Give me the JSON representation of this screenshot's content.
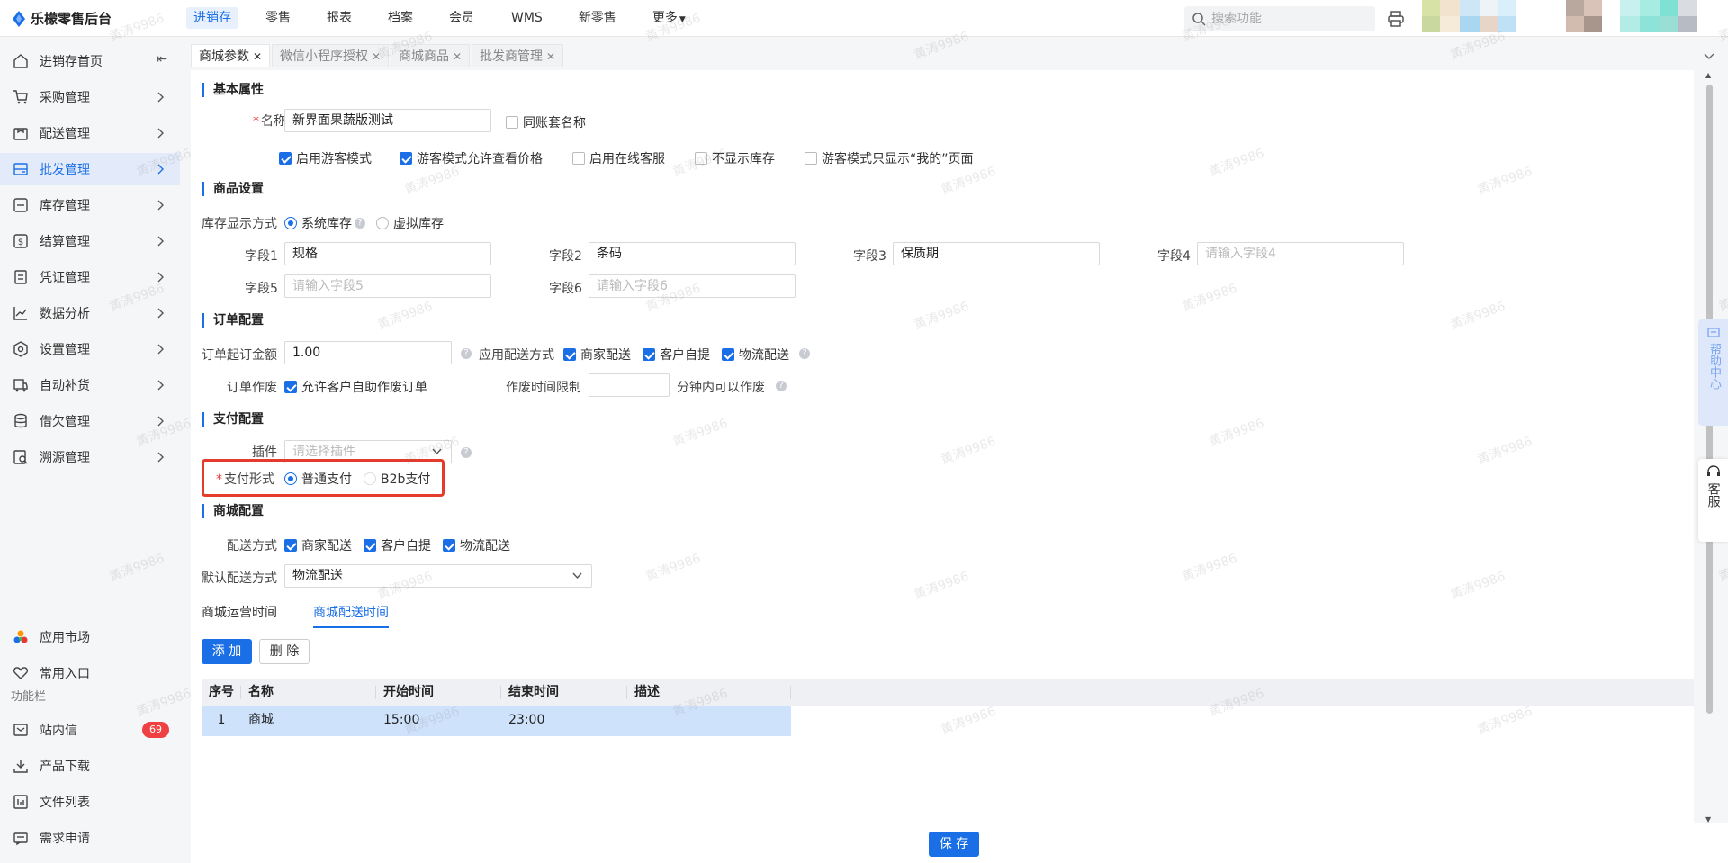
{
  "app": {
    "title": "乐檬零售后台"
  },
  "topnav": {
    "items": [
      {
        "label": "进销存",
        "active": true
      },
      {
        "label": "零售"
      },
      {
        "label": "报表"
      },
      {
        "label": "档案"
      },
      {
        "label": "会员"
      },
      {
        "label": "WMS"
      },
      {
        "label": "新零售"
      },
      {
        "label": "更多"
      }
    ]
  },
  "search": {
    "placeholder": "搜索功能"
  },
  "sidebar": {
    "items": [
      {
        "label": "进销存首页",
        "icon": "home-icon"
      },
      {
        "label": "采购管理",
        "icon": "cart-icon"
      },
      {
        "label": "配送管理",
        "icon": "box-icon"
      },
      {
        "label": "批发管理",
        "icon": "wholesale-icon",
        "active": true
      },
      {
        "label": "库存管理",
        "icon": "inventory-icon"
      },
      {
        "label": "结算管理",
        "icon": "money-icon"
      },
      {
        "label": "凭证管理",
        "icon": "voucher-icon"
      },
      {
        "label": "数据分析",
        "icon": "chart-icon"
      },
      {
        "label": "设置管理",
        "icon": "settings-icon"
      },
      {
        "label": "自动补货",
        "icon": "truck-icon"
      },
      {
        "label": "借欠管理",
        "icon": "database-icon"
      },
      {
        "label": "溯源管理",
        "icon": "trace-icon"
      }
    ],
    "bottom": [
      {
        "label": "应用市场",
        "icon": "app-market-icon"
      },
      {
        "label": "常用入口",
        "icon": "heart-icon"
      }
    ],
    "section_label": "功能栏",
    "func": [
      {
        "label": "站内信",
        "icon": "mail-icon",
        "badge": "69"
      },
      {
        "label": "产品下载",
        "icon": "download-icon"
      },
      {
        "label": "文件列表",
        "icon": "file-list-icon"
      },
      {
        "label": "需求申请",
        "icon": "request-icon"
      }
    ]
  },
  "tabs": [
    {
      "label": "商城参数",
      "active": true
    },
    {
      "label": "微信小程序授权"
    },
    {
      "label": "商城商品"
    },
    {
      "label": "批发商管理"
    }
  ],
  "basic": {
    "title": "基本属性",
    "name_label": "名称",
    "name_value": "新界面果蔬版测试",
    "same_name": "同账套名称",
    "opts": [
      {
        "label": "启用游客模式",
        "checked": true
      },
      {
        "label": "游客模式允许查看价格",
        "checked": true
      },
      {
        "label": "启用在线客服",
        "checked": false
      },
      {
        "label": "不显示库存",
        "checked": false
      },
      {
        "label": "游客模式只显示“我的”页面",
        "checked": false
      }
    ]
  },
  "goods": {
    "title": "商品设置",
    "stock_label": "库存显示方式",
    "stock_opts": [
      "系统库存",
      "虚拟库存"
    ],
    "fields": [
      {
        "label": "字段1",
        "value": "规格",
        "placeholder": ""
      },
      {
        "label": "字段2",
        "value": "条码",
        "placeholder": ""
      },
      {
        "label": "字段3",
        "value": "保质期",
        "placeholder": ""
      },
      {
        "label": "字段4",
        "value": "",
        "placeholder": "请输入字段4"
      },
      {
        "label": "字段5",
        "value": "",
        "placeholder": "请输入字段5"
      },
      {
        "label": "字段6",
        "value": "",
        "placeholder": "请输入字段6"
      }
    ]
  },
  "order": {
    "title": "订单配置",
    "min_label": "订单起订金额",
    "min_value": "1.00",
    "delivery_label": "应用配送方式",
    "delivery_opts": [
      "商家配送",
      "客户自提",
      "物流配送"
    ],
    "void_label": "订单作废",
    "void_opt": "允许客户自助作废订单",
    "limit_label": "作废时间限制",
    "limit_suffix": "分钟内可以作废"
  },
  "pay": {
    "title": "支付配置",
    "plugin_label": "插件",
    "plugin_placeholder": "请选择插件",
    "form_label": "支付形式",
    "form_opts": [
      "普通支付",
      "B2b支付"
    ]
  },
  "mall": {
    "title": "商城配置",
    "delivery_label": "配送方式",
    "delivery_opts": [
      "商家配送",
      "客户自提",
      "物流配送"
    ],
    "default_label": "默认配送方式",
    "default_value": "物流配送",
    "subtabs": [
      "商城运营时间",
      "商城配送时间"
    ],
    "add_btn": "添 加",
    "del_btn": "删 除",
    "columns": [
      "序号",
      "名称",
      "开始时间",
      "结束时间",
      "描述"
    ],
    "rows": [
      {
        "no": "1",
        "name": "商城",
        "start": "15:00",
        "end": "23:00",
        "desc": ""
      }
    ]
  },
  "save_btn": "保 存",
  "help_center": "帮助中心",
  "kefu": "客服",
  "watermark": "黄涛9986",
  "colors": {
    "accent": "#1b6fe6",
    "highlight": "#e53b2c"
  }
}
